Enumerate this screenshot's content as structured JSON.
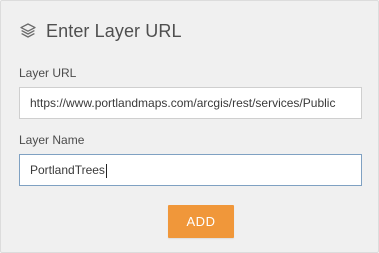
{
  "dialog": {
    "title": "Enter Layer URL",
    "icon": "layers-icon"
  },
  "fields": {
    "url": {
      "label": "Layer URL",
      "value": "https://www.portlandmaps.com/arcgis/rest/services/Public"
    },
    "name": {
      "label": "Layer Name",
      "value": "PortlandTrees"
    }
  },
  "actions": {
    "add_label": "ADD"
  },
  "colors": {
    "panel_bg": "#f0f0f0",
    "accent": "#f0973a",
    "focus_border": "#7fa1c2",
    "text": "#4f4f4f"
  }
}
